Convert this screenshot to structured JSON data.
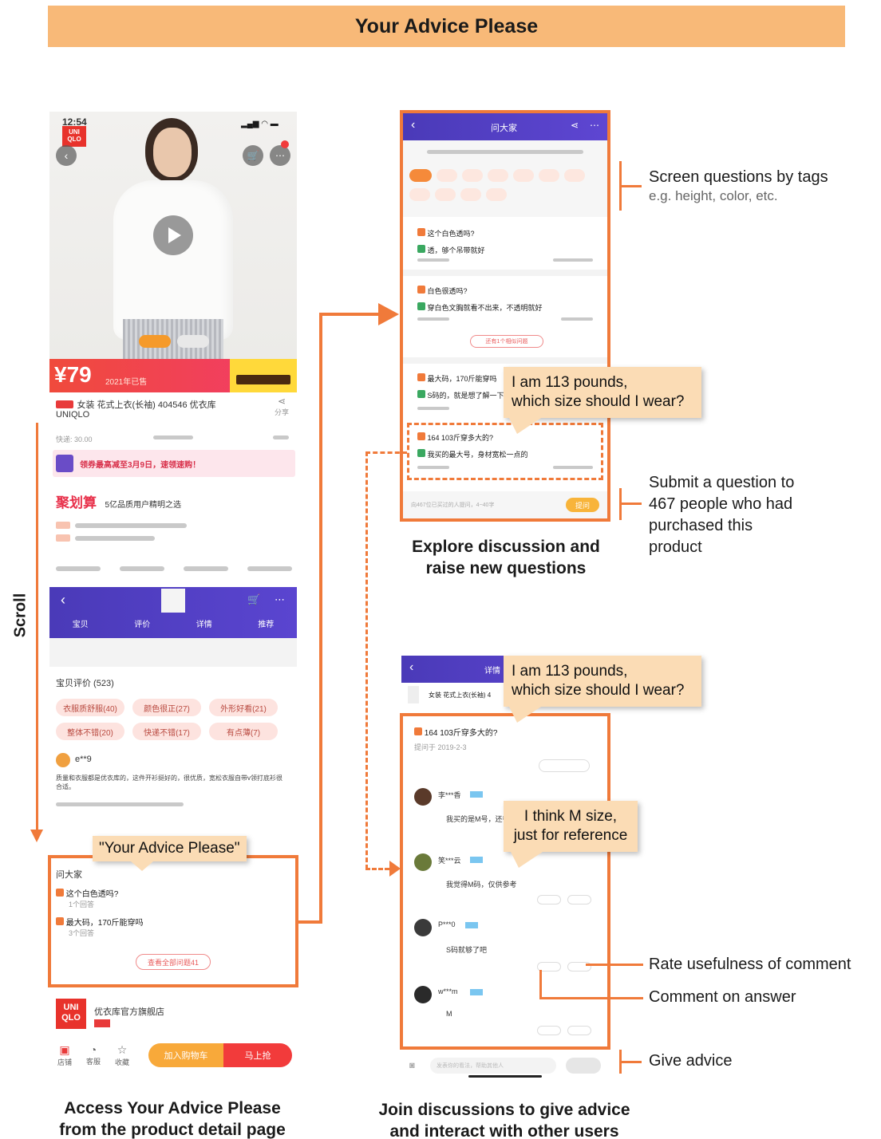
{
  "banner": {
    "title": "Your Advice Please"
  },
  "left_phone": {
    "status_time": "12:54",
    "brand": "UNI QLO",
    "price": "¥79",
    "price_sub": "2021年已售",
    "product_title": "女装 花式上衣(长袖) 404546 优衣库",
    "brand_name": "UNIQLO",
    "shipping": "快递: 30.00",
    "share": "分享",
    "promo_text": "领券最高减至3月9日，速领速购！",
    "jhs_logo": "聚划算",
    "jhs_sub": "5亿品质用户精明之选",
    "nav_tabs": [
      "宝贝",
      "评价",
      "详情",
      "推荐"
    ],
    "review_title": "宝贝评价 (523)",
    "review_tags": [
      "衣服质舒服(40)",
      "颜色很正(27)",
      "外形好看(21)",
      "整体不错(20)",
      "快递不错(17)",
      "有点薄(7)"
    ],
    "reviewer": "e**9",
    "review_body": "质量和衣服都是优衣库的，这件开衫挺好的，很优质，宽松衣服自带v领打底衫很合适。",
    "ask_header": "问大家",
    "ask_q1": "这个白色透吗?",
    "ask_q1_meta": "1个回答",
    "ask_q2": "最大码，170斤能穿吗",
    "ask_q2_meta": "3个回答",
    "ask_all": "查看全部问题41",
    "store_name": "优衣库官方旗舰店",
    "btn_cart": "加入购物车",
    "btn_buy": "马上抢",
    "bottom_icons": [
      "店铺",
      "客服",
      "收藏"
    ]
  },
  "callouts": {
    "advice_tag": "\"Your Advice Please\"",
    "q_113_a": "I am 113 pounds,",
    "q_113_b": "which size should I wear?",
    "q_113_c": "I am 113 pounds,",
    "q_113_d": "which size should I wear?",
    "m_size_a": "I think M size,",
    "m_size_b": "just for reference"
  },
  "mid_top_phone": {
    "header_title": "问大家",
    "q1": "这个白色透吗?",
    "q1_answer": "透，够个吊带就好",
    "q2": "白色很透吗?",
    "q2_answer": "穿白色文胸就看不出来，不透明就好",
    "more_answers": "还有1个相似问题",
    "q3": "最大码，170斤能穿吗",
    "q3_answer": "S码的，就是想了解一下",
    "q4": "164 103斤穿多大的?",
    "q4_answer": "我买的最大号，身材宽松一点的",
    "input_placeholder": "向467位已买过的人提问，4~40字",
    "submit": "提问"
  },
  "mid_bottom_phone": {
    "header_title": "详情",
    "product_line": "女装 花式上衣(长袖) 4",
    "question": "164    103斤穿多大的?",
    "question_meta": "提问于 2019-2-3",
    "users": [
      "李***香",
      "笑***云",
      "P***0",
      "w***m"
    ],
    "answers": [
      "我买的是M号，还行",
      "我觉得M码，仅供参考",
      "S码就够了吧",
      "M"
    ],
    "comment_input": "发表你的看法，帮助其他人"
  },
  "annotations": {
    "screen_tags": "Screen questions by tags",
    "screen_tags_sub": "e.g. height, color, etc.",
    "submit_q1": "Submit a question to",
    "submit_q2": "467 people who had",
    "submit_q3": "purchased this",
    "submit_q4": "product",
    "rate": "Rate usefulness of comment",
    "comment": "Comment on answer",
    "give": "Give advice",
    "scroll": "Scroll"
  },
  "captions": {
    "left_1": "Access Your Advice Please",
    "left_2": "from the product detail page",
    "mid_1": "Explore discussion and",
    "mid_2": "raise new questions",
    "bot_1": "Join discussions to give advice",
    "bot_2": "and interact with other users"
  },
  "colors": {
    "accent": "#f07a3a",
    "banner": "#f8b978",
    "callout": "#fbdcb5",
    "purple": "#5a3fc0",
    "red": "#f23b3b"
  }
}
